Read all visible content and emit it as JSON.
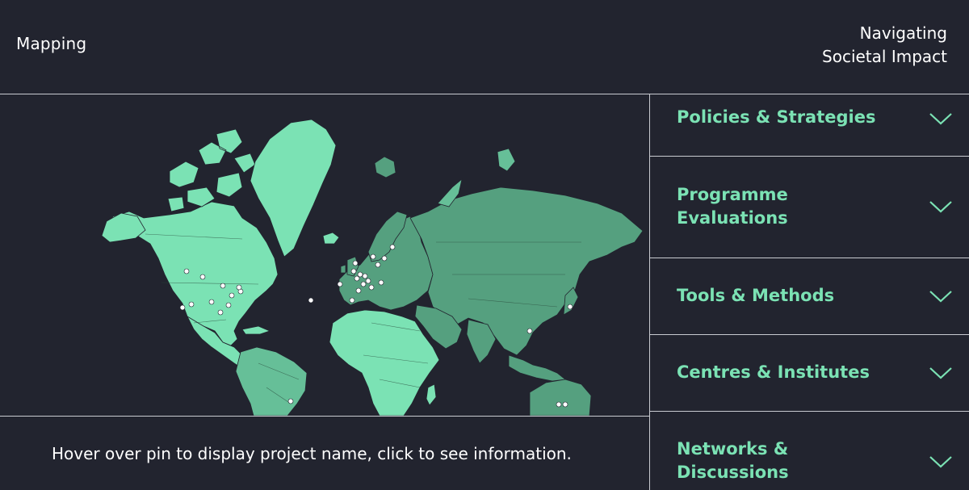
{
  "header": {
    "brand": "Mapping",
    "title_line1": "Navigating",
    "title_line2": "Societal Impact"
  },
  "map": {
    "hint": "Hover over pin to display project name, click to see information."
  },
  "accordion": {
    "items": [
      {
        "label": "Policies & Strategies",
        "icon": "chevron-down-icon"
      },
      {
        "label": "Programme Evaluations",
        "icon": "chevron-down-icon"
      },
      {
        "label": "Tools & Methods",
        "icon": "chevron-down-icon"
      },
      {
        "label": "Centres & Institutes",
        "icon": "chevron-down-icon"
      },
      {
        "label": "Networks & Discussions",
        "icon": "chevron-down-icon"
      }
    ]
  },
  "colors": {
    "background": "#22242f",
    "accent": "#7be2b4",
    "land_light": "#7be2b4",
    "land_mid": "#66bf98",
    "land_dark": "#55a07f",
    "divider": "#c9cbd1"
  }
}
